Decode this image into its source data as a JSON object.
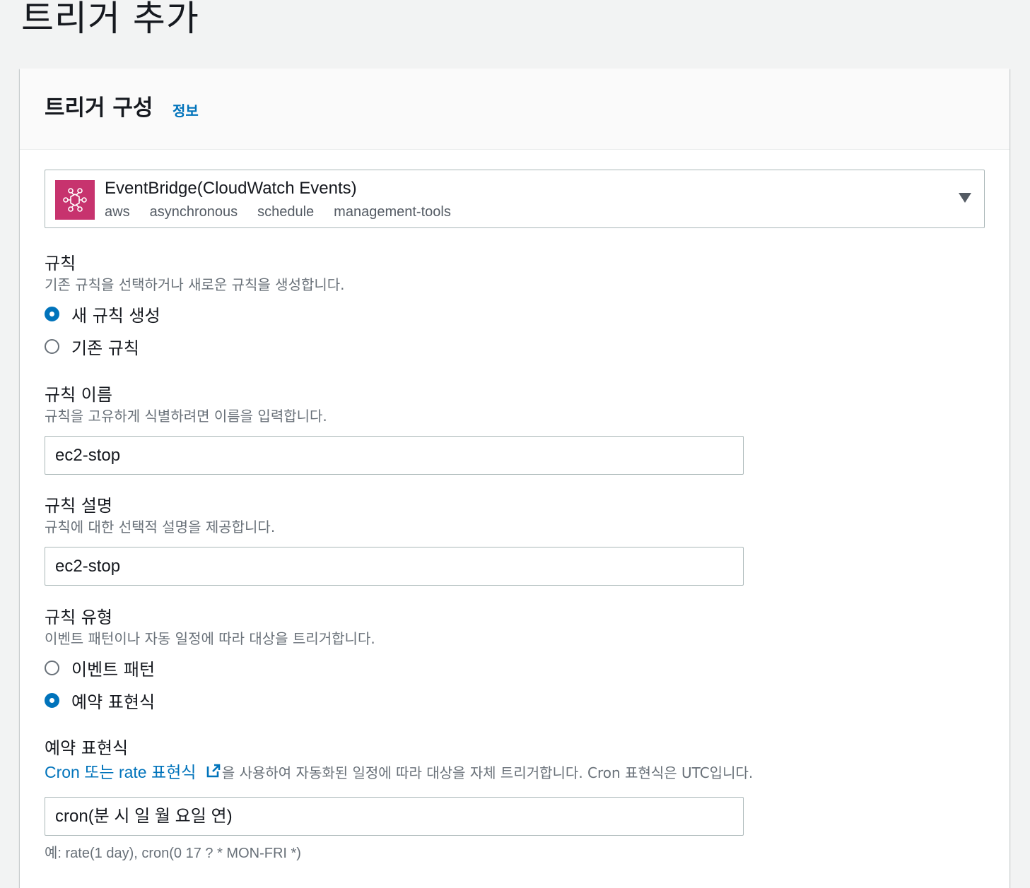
{
  "page": {
    "title": "트리거 추가"
  },
  "card": {
    "title": "트리거 구성",
    "info_link": "정보"
  },
  "trigger": {
    "service_name": "EventBridge(CloudWatch Events)",
    "tags": [
      "aws",
      "asynchronous",
      "schedule",
      "management-tools"
    ],
    "icon": "eventbridge-icon",
    "icon_color": "#c7336e"
  },
  "rule": {
    "label": "규칙",
    "description": "기존 규칙을 선택하거나 새로운 규칙을 생성합니다.",
    "options": [
      {
        "label": "새 규칙 생성",
        "selected": true
      },
      {
        "label": "기존 규칙",
        "selected": false
      }
    ]
  },
  "rule_name": {
    "label": "규칙 이름",
    "description": "규칙을 고유하게 식별하려면 이름을 입력합니다.",
    "value": "ec2-stop"
  },
  "rule_description": {
    "label": "규칙 설명",
    "description": "규칙에 대한 선택적 설명을 제공합니다.",
    "value": "ec2-stop"
  },
  "rule_type": {
    "label": "규칙 유형",
    "description": "이벤트 패턴이나 자동 일정에 따라 대상을 트리거합니다.",
    "options": [
      {
        "label": "이벤트 패턴",
        "selected": false
      },
      {
        "label": "예약 표현식",
        "selected": true
      }
    ]
  },
  "schedule_expression": {
    "label": "예약 표현식",
    "link_text": "Cron 또는 rate 표현식",
    "description_rest": "을 사용하여 자동화된 일정에 따라 대상을 자체 트리거합니다. Cron 표현식은 UTC입니다.",
    "placeholder": "cron(분 시 일 월 요일 연)",
    "hint_prefix": "예",
    "hint": ": rate(1 day), cron(0 17 ? * MON-FRI *)"
  },
  "colors": {
    "accent": "#0073bb",
    "text": "#16191f",
    "muted": "#687078",
    "border": "#aab7b8"
  }
}
